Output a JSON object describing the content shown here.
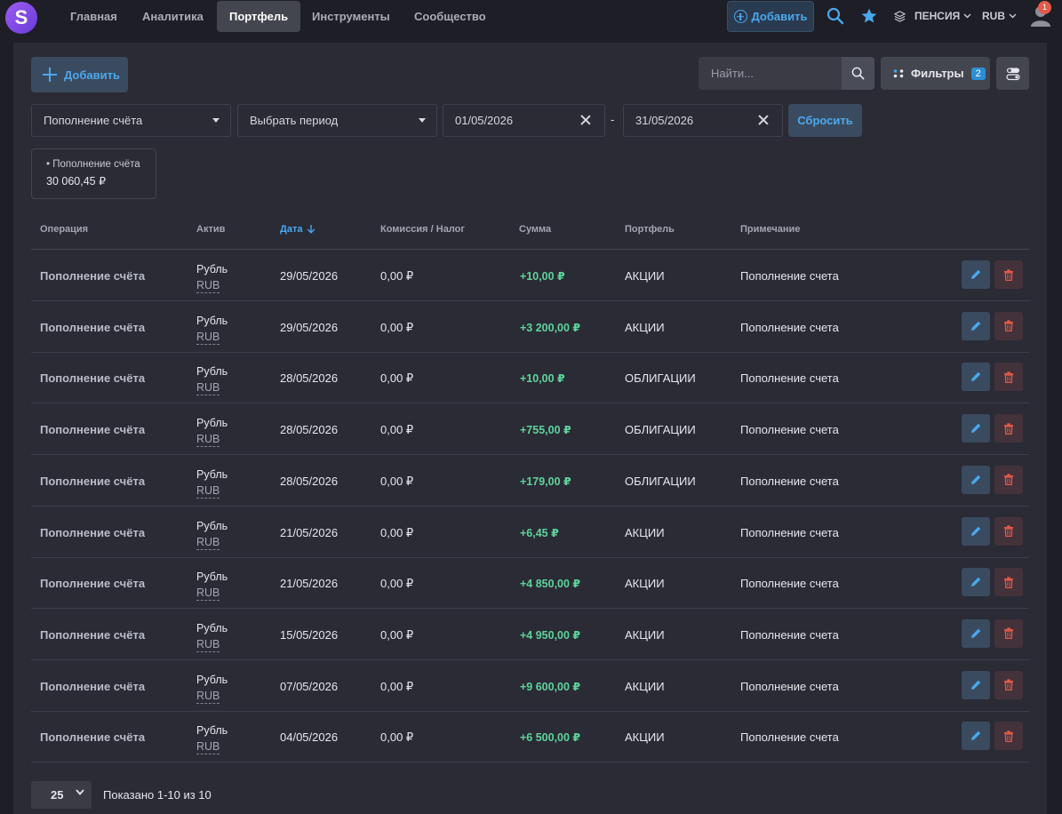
{
  "nav": {
    "logo": "S",
    "links": [
      "Главная",
      "Аналитика",
      "Портфель",
      "Инструменты",
      "Сообщество"
    ],
    "active_link": "Портфель",
    "add_label": "Добавить",
    "portfolio_label": "ПЕНСИЯ",
    "currency_label": "RUB",
    "notifications_count": "1",
    "icons": [
      "search-icon",
      "star-icon",
      "layers-icon",
      "user-icon"
    ]
  },
  "toolbar": {
    "add_label": "Добавить",
    "search_placeholder": "Найти...",
    "filters_label": "Фильтры",
    "filters_count": "2"
  },
  "filters": {
    "operation_type": "Пополнение счёта",
    "period": "Выбрать период",
    "date_from": "01/05/2026",
    "date_to": "31/05/2026",
    "separator": "-",
    "reset_label": "Сбросить"
  },
  "summary": {
    "label": "• Пополнение счёта",
    "value": "30 060,45 ₽"
  },
  "table": {
    "headers": {
      "operation": "Операция",
      "asset": "Актив",
      "date": "Дата",
      "fee": "Комиссия / Налог",
      "sum": "Сумма",
      "portfolio": "Портфель",
      "note": "Примечание"
    },
    "sort_column": "date",
    "sort_direction": "desc",
    "rows": [
      {
        "operation": "Пополнение счёта",
        "asset": "Рубль",
        "asset_code": "RUB",
        "date": "29/05/2026",
        "fee": "0,00 ₽",
        "sum": "+10,00 ₽",
        "portfolio": "АКЦИИ",
        "note": "Пополнение счета"
      },
      {
        "operation": "Пополнение счёта",
        "asset": "Рубль",
        "asset_code": "RUB",
        "date": "29/05/2026",
        "fee": "0,00 ₽",
        "sum": "+3 200,00 ₽",
        "portfolio": "АКЦИИ",
        "note": "Пополнение счета"
      },
      {
        "operation": "Пополнение счёта",
        "asset": "Рубль",
        "asset_code": "RUB",
        "date": "28/05/2026",
        "fee": "0,00 ₽",
        "sum": "+10,00 ₽",
        "portfolio": "ОБЛИГАЦИИ",
        "note": "Пополнение счета"
      },
      {
        "operation": "Пополнение счёта",
        "asset": "Рубль",
        "asset_code": "RUB",
        "date": "28/05/2026",
        "fee": "0,00 ₽",
        "sum": "+755,00 ₽",
        "portfolio": "ОБЛИГАЦИИ",
        "note": "Пополнение счета"
      },
      {
        "operation": "Пополнение счёта",
        "asset": "Рубль",
        "asset_code": "RUB",
        "date": "28/05/2026",
        "fee": "0,00 ₽",
        "sum": "+179,00 ₽",
        "portfolio": "ОБЛИГАЦИИ",
        "note": "Пополнение счета"
      },
      {
        "operation": "Пополнение счёта",
        "asset": "Рубль",
        "asset_code": "RUB",
        "date": "21/05/2026",
        "fee": "0,00 ₽",
        "sum": "+6,45 ₽",
        "portfolio": "АКЦИИ",
        "note": "Пополнение счета"
      },
      {
        "operation": "Пополнение счёта",
        "asset": "Рубль",
        "asset_code": "RUB",
        "date": "21/05/2026",
        "fee": "0,00 ₽",
        "sum": "+4 850,00 ₽",
        "portfolio": "АКЦИИ",
        "note": "Пополнение счета"
      },
      {
        "operation": "Пополнение счёта",
        "asset": "Рубль",
        "asset_code": "RUB",
        "date": "15/05/2026",
        "fee": "0,00 ₽",
        "sum": "+4 950,00 ₽",
        "portfolio": "АКЦИИ",
        "note": "Пополнение счета"
      },
      {
        "operation": "Пополнение счёта",
        "asset": "Рубль",
        "asset_code": "RUB",
        "date": "07/05/2026",
        "fee": "0,00 ₽",
        "sum": "+9 600,00 ₽",
        "portfolio": "АКЦИИ",
        "note": "Пополнение счета"
      },
      {
        "operation": "Пополнение счёта",
        "asset": "Рубль",
        "asset_code": "RUB",
        "date": "04/05/2026",
        "fee": "0,00 ₽",
        "sum": "+6 500,00 ₽",
        "portfolio": "АКЦИИ",
        "note": "Пополнение счета"
      }
    ],
    "row_icons": [
      "pencil-icon",
      "trash-icon"
    ]
  },
  "pagination": {
    "per_page": "25",
    "shown_text": "Показано 1-10 из 10"
  },
  "colors": {
    "accent": "#4aa8ee",
    "positive": "#5fd39a",
    "danger": "#e35b4a",
    "background": "#1e1e26",
    "panel": "#2a2b35"
  }
}
